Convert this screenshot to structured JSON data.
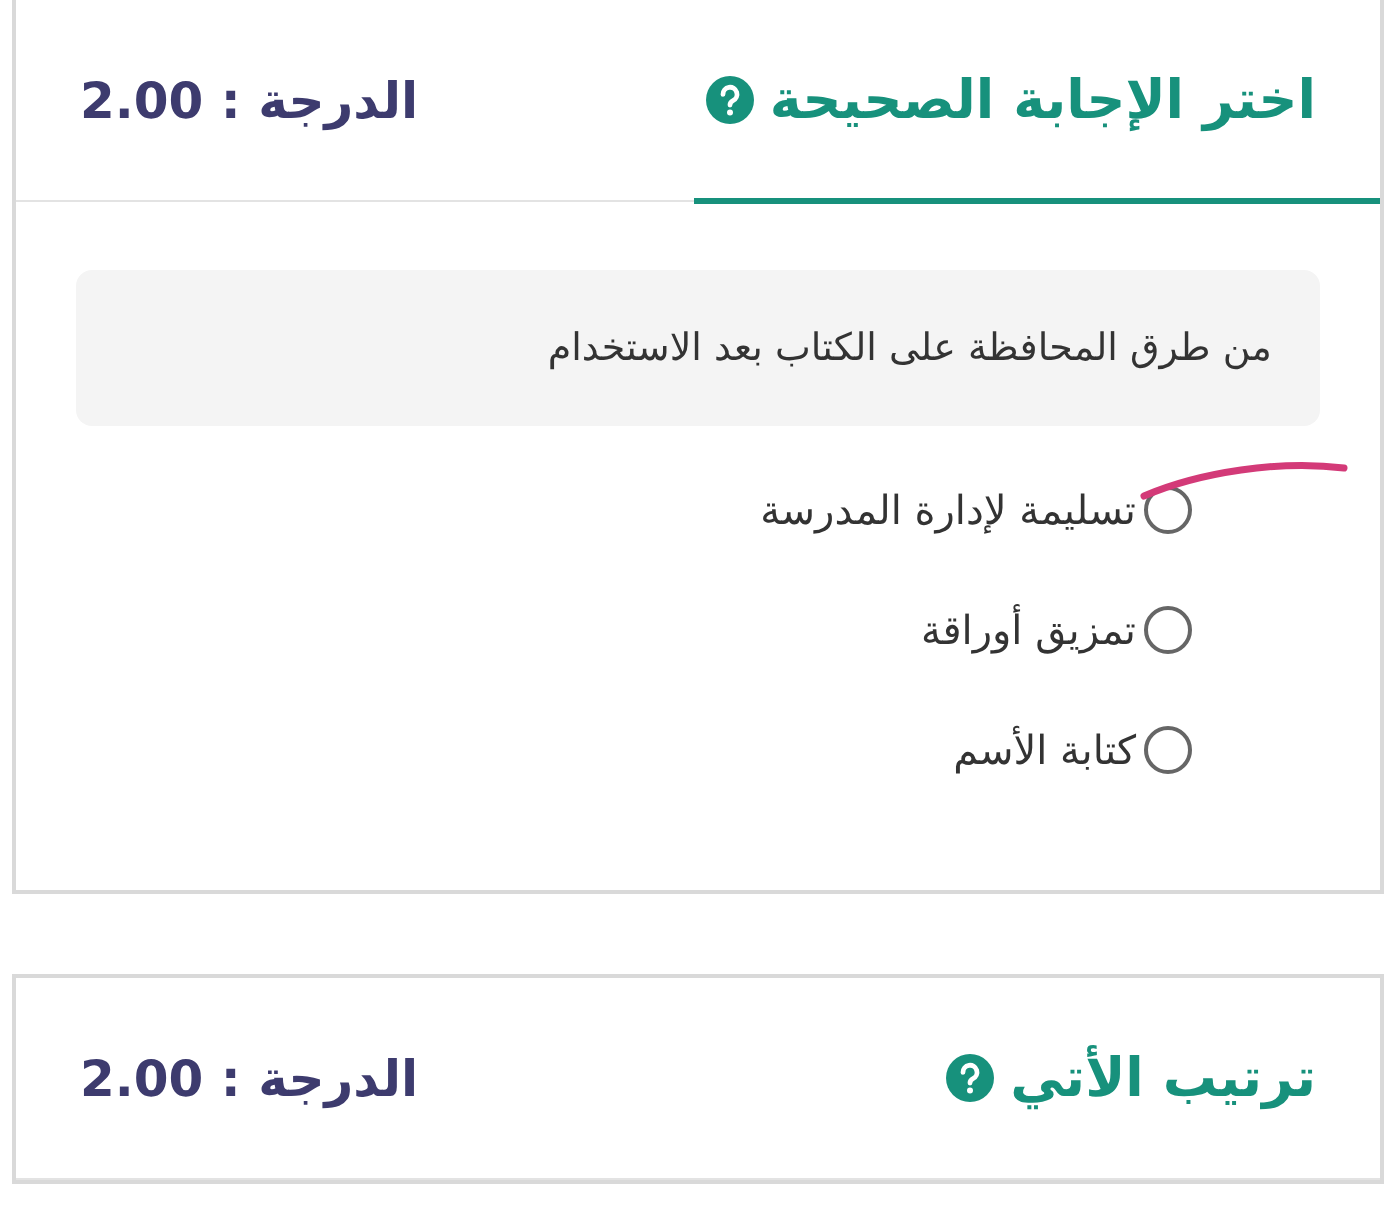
{
  "questions": [
    {
      "title": "اختر الإجابة الصحيحة",
      "score": "الدرجة : 2.00",
      "prompt": "من طرق المحافظة على الكتاب بعد الاستخدام",
      "options": [
        {
          "label": "تسليمة لإدارة المدرسة",
          "selected": false
        },
        {
          "label": "تمزيق أوراقة",
          "selected": false
        },
        {
          "label": "كتابة الأسم",
          "selected": false
        }
      ]
    },
    {
      "title": "ترتيب الأتي",
      "score": "الدرجة : 2.00"
    }
  ]
}
